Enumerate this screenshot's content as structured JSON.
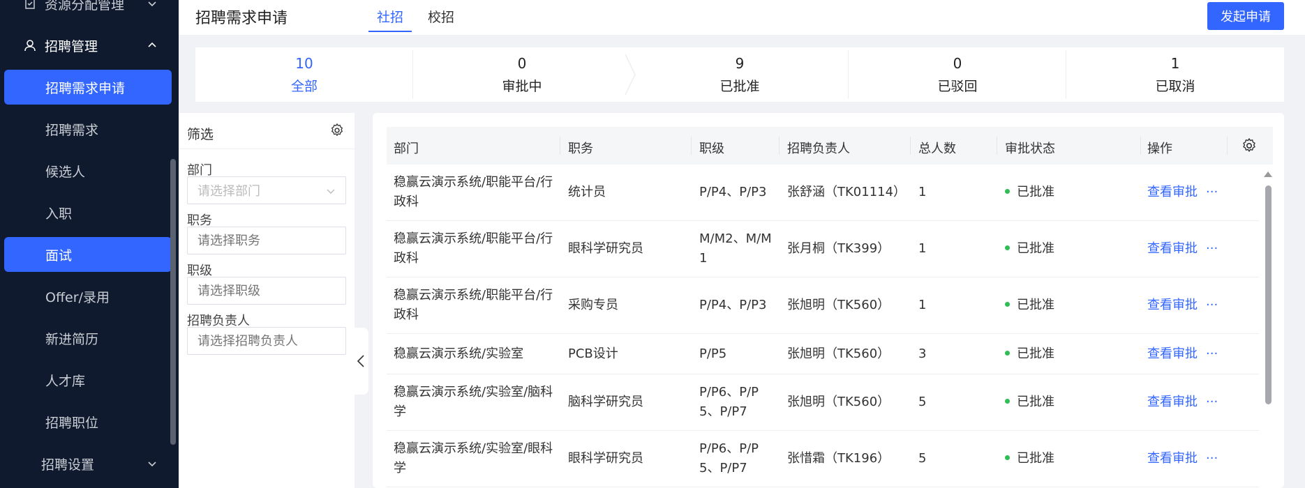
{
  "sidebar": {
    "group_resource": "资源分配管理",
    "group_recruit": "招聘管理",
    "items": [
      {
        "label": "招聘需求申请",
        "active": true
      },
      {
        "label": "招聘需求",
        "active": false
      },
      {
        "label": "候选人",
        "active": false
      },
      {
        "label": "入职",
        "active": false
      },
      {
        "label": "面试",
        "active": true
      },
      {
        "label": "Offer/录用",
        "active": false
      },
      {
        "label": "新进简历",
        "active": false
      },
      {
        "label": "人才库",
        "active": false
      },
      {
        "label": "招聘职位",
        "active": false
      }
    ],
    "group_settings": "招聘设置"
  },
  "header": {
    "title": "招聘需求申请",
    "tabs": [
      {
        "label": "社招",
        "active": true
      },
      {
        "label": "校招",
        "active": false
      }
    ],
    "create_button": "发起申请"
  },
  "status_bar": [
    {
      "count": "10",
      "label": "全部",
      "active": true
    },
    {
      "count": "0",
      "label": "审批中",
      "active": false
    },
    {
      "count": "9",
      "label": "已批准",
      "active": false
    },
    {
      "count": "0",
      "label": "已驳回",
      "active": false
    },
    {
      "count": "1",
      "label": "已取消",
      "active": false
    }
  ],
  "filter": {
    "title": "筛选",
    "fields": [
      {
        "label": "部门",
        "placeholder": "请选择部门",
        "dropdown": true
      },
      {
        "label": "职务",
        "placeholder": "请选择职务",
        "dropdown": false
      },
      {
        "label": "职级",
        "placeholder": "请选择职级",
        "dropdown": false
      },
      {
        "label": "招聘负责人",
        "placeholder": "请选择招聘负责人",
        "dropdown": false
      }
    ]
  },
  "table": {
    "columns": [
      "部门",
      "职务",
      "职级",
      "招聘负责人",
      "总人数",
      "审批状态",
      "操作"
    ],
    "rows": [
      {
        "dept": [
          "稳赢云演示系统/职能平台/行",
          "政科"
        ],
        "position": "统计员",
        "level": [
          "P/P4、P/P3"
        ],
        "owner": "张舒涵（TK01114）",
        "total": "1",
        "status": "已批准",
        "action": "查看审批",
        "more": "···"
      },
      {
        "dept": [
          "稳赢云演示系统/职能平台/行",
          "政科"
        ],
        "position": "眼科学研究员",
        "level": [
          "M/M2、M/M",
          "1"
        ],
        "owner": "张月桐（TK399）",
        "total": "1",
        "status": "已批准",
        "action": "查看审批",
        "more": "···"
      },
      {
        "dept": [
          "稳赢云演示系统/职能平台/行",
          "政科"
        ],
        "position": "采购专员",
        "level": [
          "P/P4、P/P3"
        ],
        "owner": "张旭明（TK560）",
        "total": "1",
        "status": "已批准",
        "action": "查看审批",
        "more": "···"
      },
      {
        "dept": [
          "稳赢云演示系统/实验室"
        ],
        "position": "PCB设计",
        "level": [
          "P/P5"
        ],
        "owner": "张旭明（TK560）",
        "total": "3",
        "status": "已批准",
        "action": "查看审批",
        "more": "···"
      },
      {
        "dept": [
          "稳赢云演示系统/实验室/脑科",
          "学"
        ],
        "position": "脑科学研究员",
        "level": [
          "P/P6、P/P",
          "5、P/P7"
        ],
        "owner": "张旭明（TK560）",
        "total": "5",
        "status": "已批准",
        "action": "查看审批",
        "more": "···"
      },
      {
        "dept": [
          "稳赢云演示系统/实验室/眼科",
          "学"
        ],
        "position": "眼科学研究员",
        "level": [
          "P/P6、P/P",
          "5、P/P7"
        ],
        "owner": "张惜霜（TK196）",
        "total": "5",
        "status": "已批准",
        "action": "查看审批",
        "more": "···"
      }
    ]
  },
  "colors": {
    "accent": "#3366ff",
    "sidebar_bg": "#0f1a2e",
    "approved_dot": "#2fbd56"
  }
}
